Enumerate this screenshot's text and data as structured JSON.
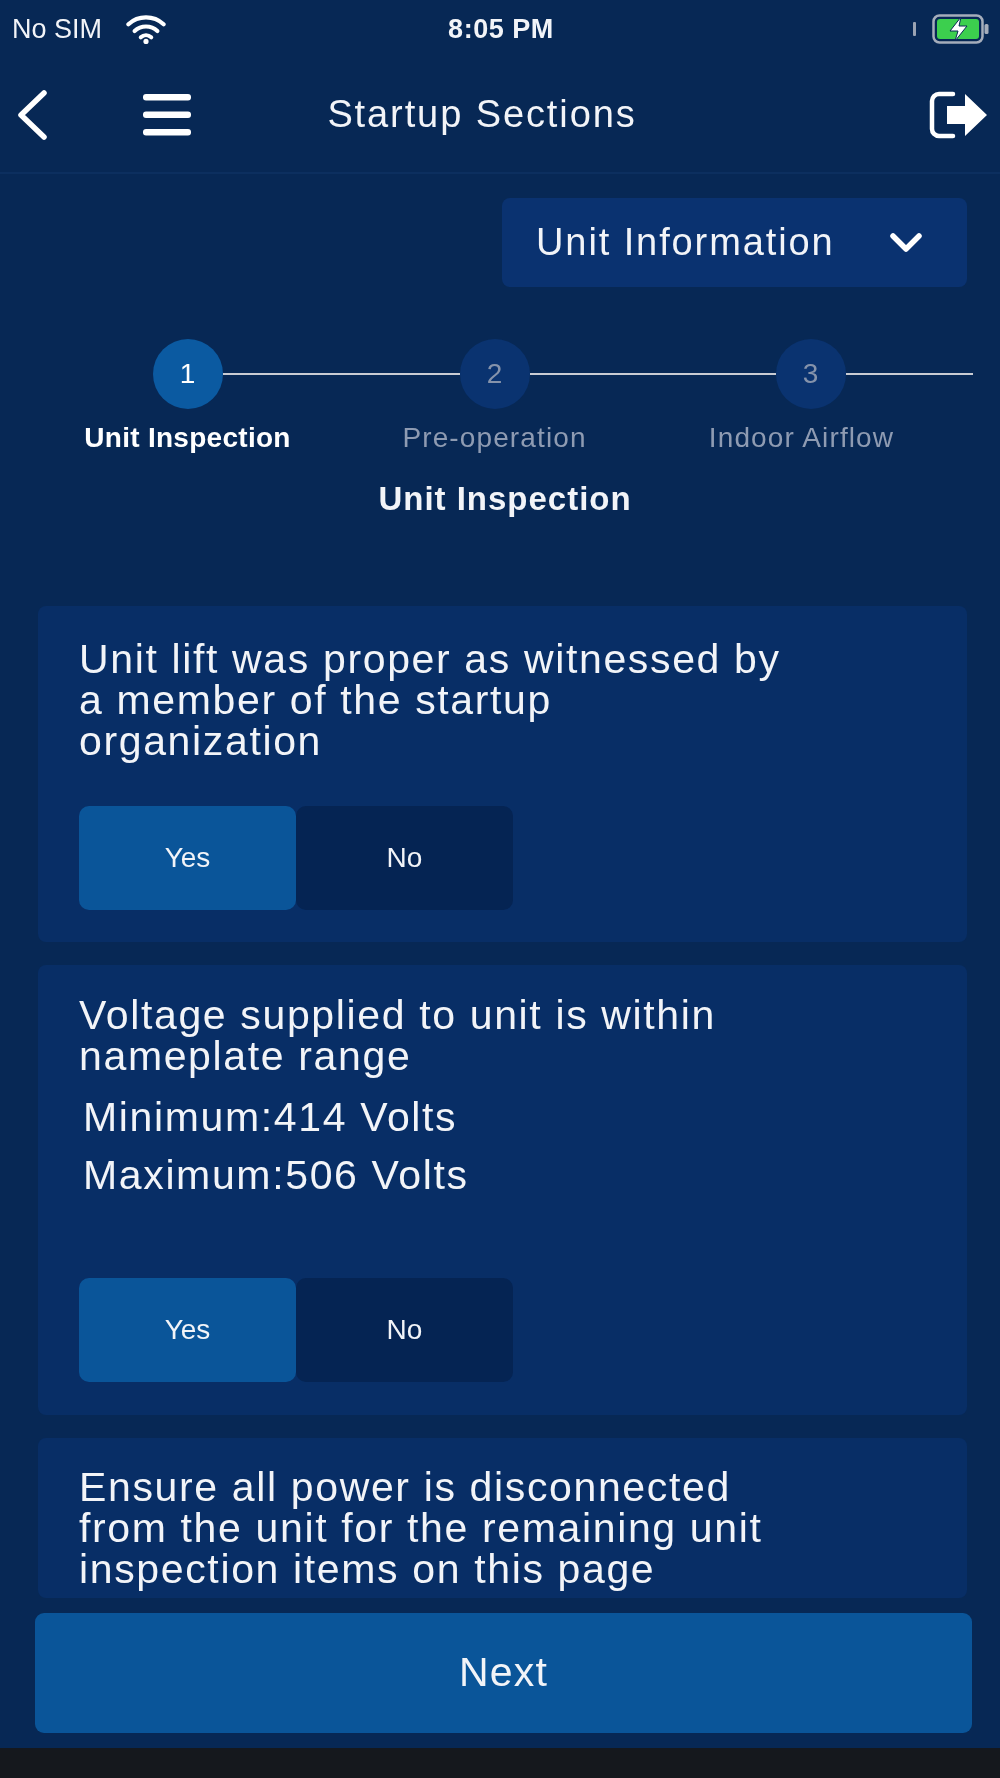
{
  "status_bar": {
    "carrier": "No SIM",
    "time": "8:05 PM",
    "charging": true
  },
  "header": {
    "title": "Startup Sections"
  },
  "section_dropdown": {
    "value": "Unit Information"
  },
  "steps": [
    {
      "number": "1",
      "label": "Unit Inspection",
      "selected": true
    },
    {
      "number": "2",
      "label": "Pre-operation",
      "selected": false
    },
    {
      "number": "3",
      "label": "Indoor Airflow",
      "selected": false
    }
  ],
  "current_section": "Unit Inspection",
  "questions": [
    {
      "text": "Unit lift was proper as witnessed by a member of the startup organization",
      "options": [
        {
          "label": "Yes",
          "selected": true
        },
        {
          "label": "No",
          "selected": false
        }
      ]
    },
    {
      "text": "Voltage supplied to unit is within nameplate range",
      "details": [
        "Minimum:414 Volts",
        "Maximum:506 Volts"
      ],
      "options": [
        {
          "label": "Yes",
          "selected": true
        },
        {
          "label": "No",
          "selected": false
        }
      ]
    },
    {
      "text": "Ensure all power is disconnected from the unit for the remaining unit inspection items on this page"
    }
  ],
  "next_button": {
    "label": "Next"
  }
}
